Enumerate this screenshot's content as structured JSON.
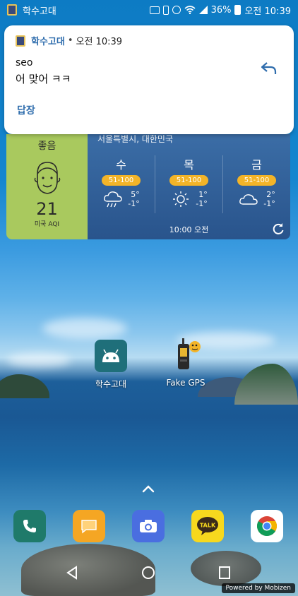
{
  "status_bar": {
    "app_name": "학수고대",
    "battery": "36%",
    "time": "오전 10:39",
    "icons": [
      "app-icon",
      "cast-icon",
      "vibrate-icon",
      "alarm-icon",
      "wifi-icon",
      "signal-icon",
      "battery-icon"
    ]
  },
  "notification": {
    "app_name": "학수고대",
    "separator": "•",
    "time": "오전 10:39",
    "sender": "seo",
    "message": "어 맞어 ㅋㅋ",
    "reply_label": "답장",
    "accent": "#2f6dad"
  },
  "weather": {
    "aqi_status": "좋음",
    "aqi_value": "21",
    "aqi_unit": "미국 AQI",
    "location": "서울특별시, 대한민국",
    "days": [
      {
        "name": "수",
        "badge": "51-100",
        "high": "5°",
        "low": "-1°",
        "icon": "cloud-rain-icon"
      },
      {
        "name": "목",
        "badge": "51-100",
        "high": "1°",
        "low": "-1°",
        "icon": "sun-icon"
      },
      {
        "name": "금",
        "badge": "51-100",
        "high": "2°",
        "low": "-1°",
        "icon": "cloud-icon"
      }
    ],
    "updated": "10:00 오전",
    "aqi_color": "#a9c95e",
    "badge_color": "#f3b428"
  },
  "apps": [
    {
      "label": "학수고대",
      "icon": "android-icon"
    },
    {
      "label": "Fake GPS",
      "icon": "gps-device-icon"
    }
  ],
  "dock": [
    {
      "name": "phone-icon"
    },
    {
      "name": "messages-icon"
    },
    {
      "name": "camera-icon"
    },
    {
      "name": "kakaotalk-icon",
      "text": "TALK"
    },
    {
      "name": "chrome-icon"
    }
  ],
  "powered_by": "Powered by Mobizen"
}
